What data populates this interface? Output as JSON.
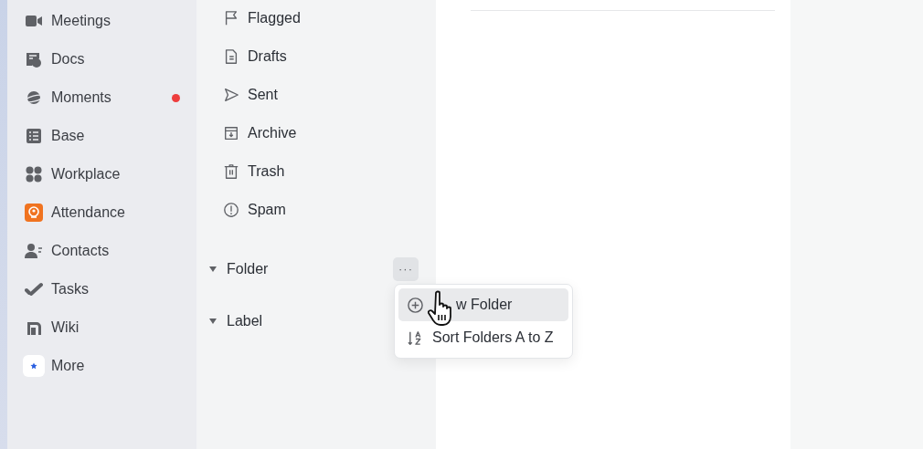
{
  "nav": {
    "items": [
      {
        "label": "Meetings",
        "unread": false
      },
      {
        "label": "Docs",
        "unread": false
      },
      {
        "label": "Moments",
        "unread": true
      },
      {
        "label": "Base",
        "unread": false
      },
      {
        "label": "Workplace",
        "unread": false
      },
      {
        "label": "Attendance",
        "unread": false
      },
      {
        "label": "Contacts",
        "unread": false
      },
      {
        "label": "Tasks",
        "unread": false
      },
      {
        "label": "Wiki",
        "unread": false
      },
      {
        "label": "More",
        "unread": false
      }
    ]
  },
  "mail_folders": {
    "items": [
      {
        "label": "Flagged"
      },
      {
        "label": "Drafts"
      },
      {
        "label": "Sent"
      },
      {
        "label": "Archive"
      },
      {
        "label": "Trash"
      },
      {
        "label": "Spam"
      }
    ],
    "sections": [
      {
        "label": "Folder",
        "expanded": true,
        "more_button": "···"
      },
      {
        "label": "Label",
        "expanded": true
      }
    ]
  },
  "context_menu": {
    "items": [
      {
        "label": "w Folder",
        "selected": true
      },
      {
        "label": "Sort Folders A to Z",
        "selected": false
      }
    ]
  }
}
